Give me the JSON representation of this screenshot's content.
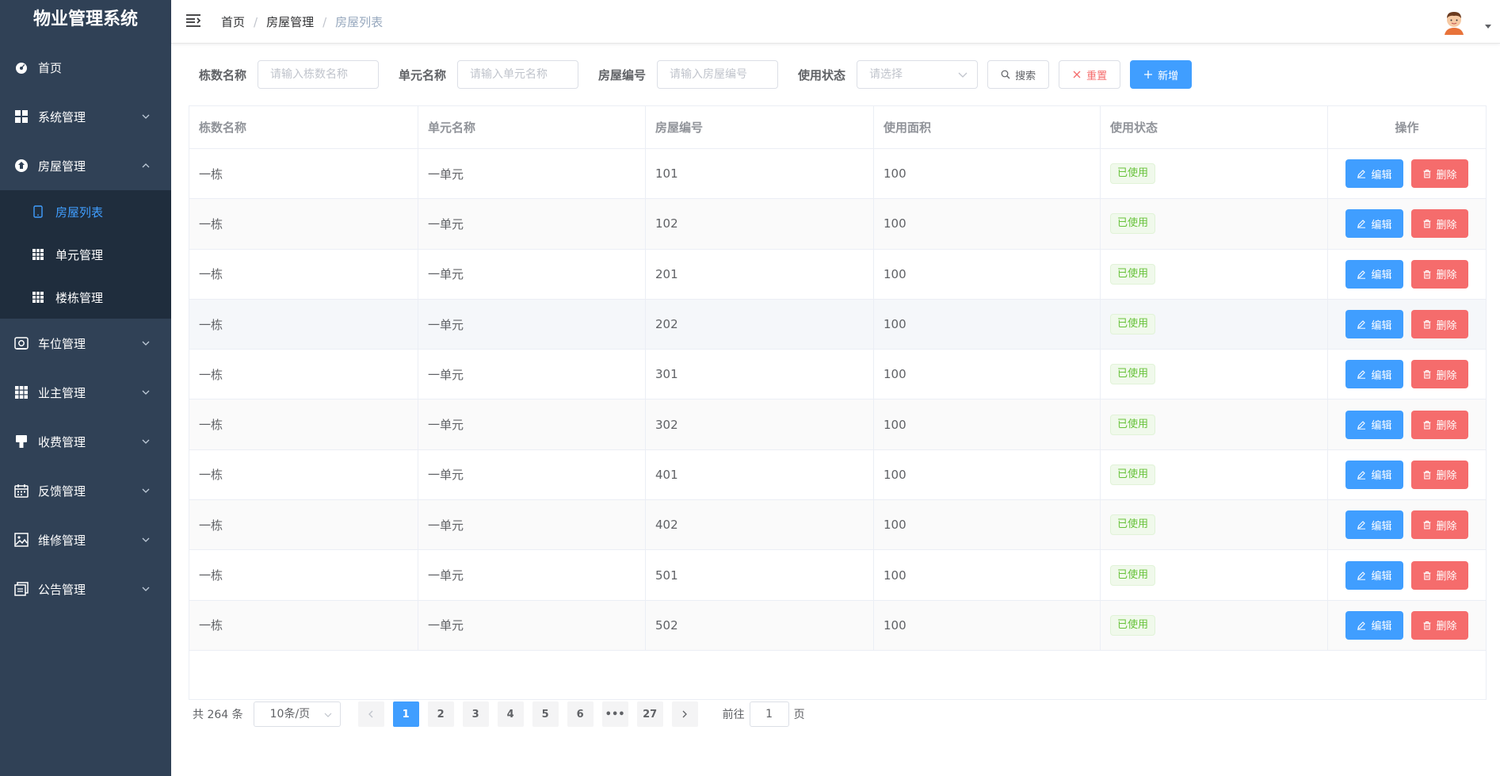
{
  "app": {
    "title": "物业管理系统"
  },
  "sidebar": {
    "items": [
      {
        "label": "首页",
        "icon": "dashboard-icon"
      },
      {
        "label": "系统管理",
        "icon": "grid-icon"
      },
      {
        "label": "房屋管理",
        "icon": "house-icon",
        "expanded": true,
        "children": [
          {
            "label": "房屋列表",
            "icon": "phone-icon",
            "active": true
          },
          {
            "label": "单元管理",
            "icon": "table-icon"
          },
          {
            "label": "楼栋管理",
            "icon": "table-icon"
          }
        ]
      },
      {
        "label": "车位管理",
        "icon": "parking-icon"
      },
      {
        "label": "业主管理",
        "icon": "apps-icon"
      },
      {
        "label": "收费管理",
        "icon": "brush-icon"
      },
      {
        "label": "反馈管理",
        "icon": "calendar-icon"
      },
      {
        "label": "维修管理",
        "icon": "picture-icon"
      },
      {
        "label": "公告管理",
        "icon": "document-icon"
      }
    ]
  },
  "breadcrumb": [
    "首页",
    "房屋管理",
    "房屋列表"
  ],
  "search": {
    "building_label": "栋数名称",
    "building_placeholder": "请输入栋数名称",
    "unit_label": "单元名称",
    "unit_placeholder": "请输入单元名称",
    "room_label": "房屋编号",
    "room_placeholder": "请输入房屋编号",
    "status_label": "使用状态",
    "status_placeholder": "请选择",
    "search_btn": "搜索",
    "reset_btn": "重置",
    "add_btn": "新增"
  },
  "table": {
    "headers": [
      "栋数名称",
      "单元名称",
      "房屋编号",
      "使用面积",
      "使用状态",
      "操作"
    ],
    "edit_label": "编辑",
    "delete_label": "删除",
    "rows": [
      {
        "building": "一栋",
        "unit": "一单元",
        "room": "101",
        "area": "100",
        "status": "已使用"
      },
      {
        "building": "一栋",
        "unit": "一单元",
        "room": "102",
        "area": "100",
        "status": "已使用"
      },
      {
        "building": "一栋",
        "unit": "一单元",
        "room": "201",
        "area": "100",
        "status": "已使用"
      },
      {
        "building": "一栋",
        "unit": "一单元",
        "room": "202",
        "area": "100",
        "status": "已使用"
      },
      {
        "building": "一栋",
        "unit": "一单元",
        "room": "301",
        "area": "100",
        "status": "已使用"
      },
      {
        "building": "一栋",
        "unit": "一单元",
        "room": "302",
        "area": "100",
        "status": "已使用"
      },
      {
        "building": "一栋",
        "unit": "一单元",
        "room": "401",
        "area": "100",
        "status": "已使用"
      },
      {
        "building": "一栋",
        "unit": "一单元",
        "room": "402",
        "area": "100",
        "status": "已使用"
      },
      {
        "building": "一栋",
        "unit": "一单元",
        "room": "501",
        "area": "100",
        "status": "已使用"
      },
      {
        "building": "一栋",
        "unit": "一单元",
        "room": "502",
        "area": "100",
        "status": "已使用"
      }
    ]
  },
  "pagination": {
    "total": "共 264 条",
    "page_size": "10条/页",
    "pages": [
      "1",
      "2",
      "3",
      "4",
      "5",
      "6",
      "•••",
      "27"
    ],
    "current": "1",
    "goto_prefix": "前往",
    "goto_value": "1",
    "goto_suffix": "页"
  },
  "colors": {
    "sidebar_bg": "#304156",
    "submenu_bg": "#1f2d3d",
    "primary": "#409eff",
    "danger": "#f56c6c",
    "success": "#67c23a"
  }
}
